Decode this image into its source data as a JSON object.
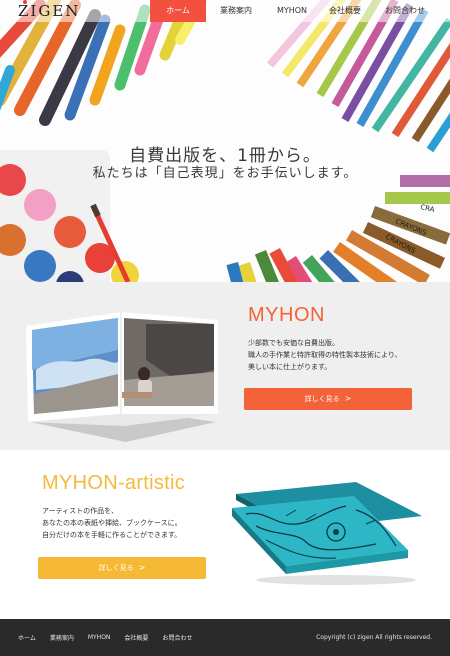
{
  "brand": {
    "logo": "ZIGEN",
    "accent": "#f3503f"
  },
  "nav": {
    "items": [
      {
        "label": "ホーム",
        "active": true
      },
      {
        "label": "業務案内",
        "active": false
      },
      {
        "label": "MYHON",
        "active": false
      },
      {
        "label": "会社概要",
        "active": false
      },
      {
        "label": "お問合わせ",
        "active": false
      }
    ]
  },
  "hero": {
    "title": "自費出版を、1冊から。",
    "subtitle": "私たちは「自己表現」をお手伝いします。",
    "crayon_labels": [
      "CRA",
      "CRAYONS",
      "CRAYONS"
    ]
  },
  "myhon": {
    "title": "MYHON",
    "description": [
      "少部数でも安価な自費出版。",
      "職人の手作業と特許取得の特性製本技術により、",
      "美しい本に仕上がります。"
    ],
    "button_label": "詳しく見る",
    "color": "#f4623a"
  },
  "artistic": {
    "title": "MYHON-artistic",
    "description": [
      "アーティストの作品を、",
      "あなたの本の表紙や挿絵、ブックケースに。",
      "自分だけの本を手軽に作ることができます。"
    ],
    "button_label": "詳しく見る",
    "color": "#f5b935"
  },
  "footer": {
    "links": [
      "ホーム",
      "業務案内",
      "MYHON",
      "会社概要",
      "お問合わせ"
    ],
    "copyright": "Copyright (c) zigen All rights reserved."
  }
}
